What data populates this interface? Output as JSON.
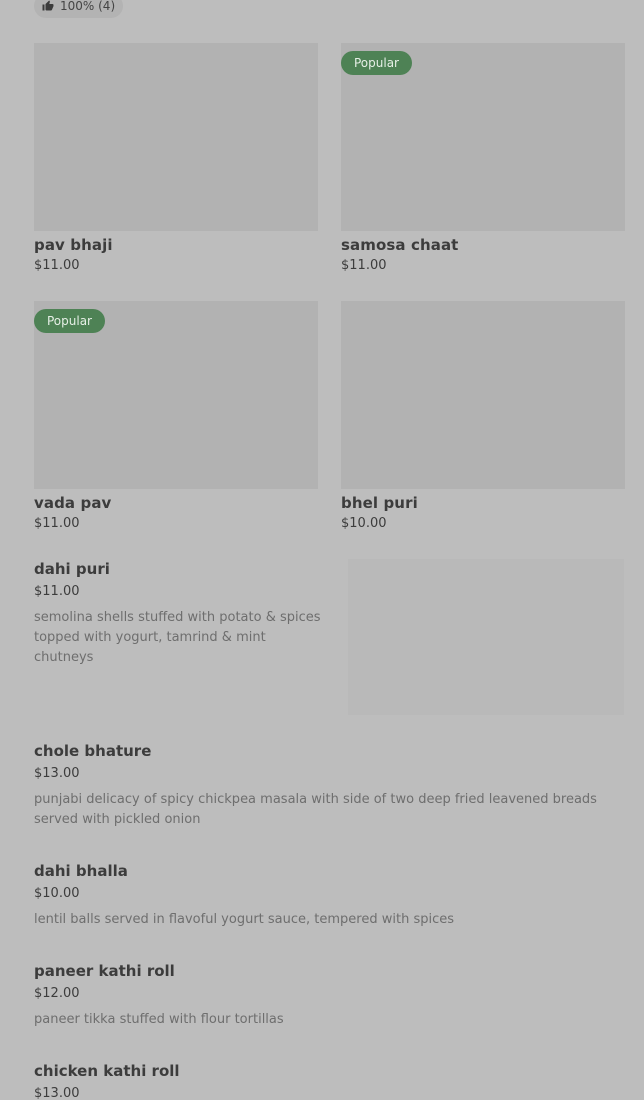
{
  "rating": {
    "label": "100% (4)",
    "icon": "thumbs-up-icon"
  },
  "badge_label": "Popular",
  "colors": {
    "page_bg": "#bdbdbd",
    "image_placeholder": "#b2b2b2",
    "badge_bg": "#4e8255"
  },
  "featured": [
    {
      "name": "pav bhaji",
      "price": "$11.00",
      "popular": false
    },
    {
      "name": "samosa chaat",
      "price": "$11.00",
      "popular": true
    },
    {
      "name": "vada pav",
      "price": "$11.00",
      "popular": true
    },
    {
      "name": "bhel puri",
      "price": "$10.00",
      "popular": false
    }
  ],
  "items": [
    {
      "name": "dahi puri",
      "price": "$11.00",
      "description": "semolina shells stuffed with potato & spices topped with yogurt, tamrind & mint chutneys"
    },
    {
      "name": "chole bhature",
      "price": "$13.00",
      "description": "punjabi delicacy of spicy chickpea masala with side of two deep fried leavened breads served with pickled onion"
    },
    {
      "name": "dahi bhalla",
      "price": "$10.00",
      "description": "lentil balls served in flavoful yogurt sauce, tempered with spices"
    },
    {
      "name": "paneer kathi roll",
      "price": "$12.00",
      "description": "paneer tikka stuffed with flour tortillas"
    },
    {
      "name": "chicken kathi roll",
      "price": "$13.00",
      "description": ""
    }
  ]
}
